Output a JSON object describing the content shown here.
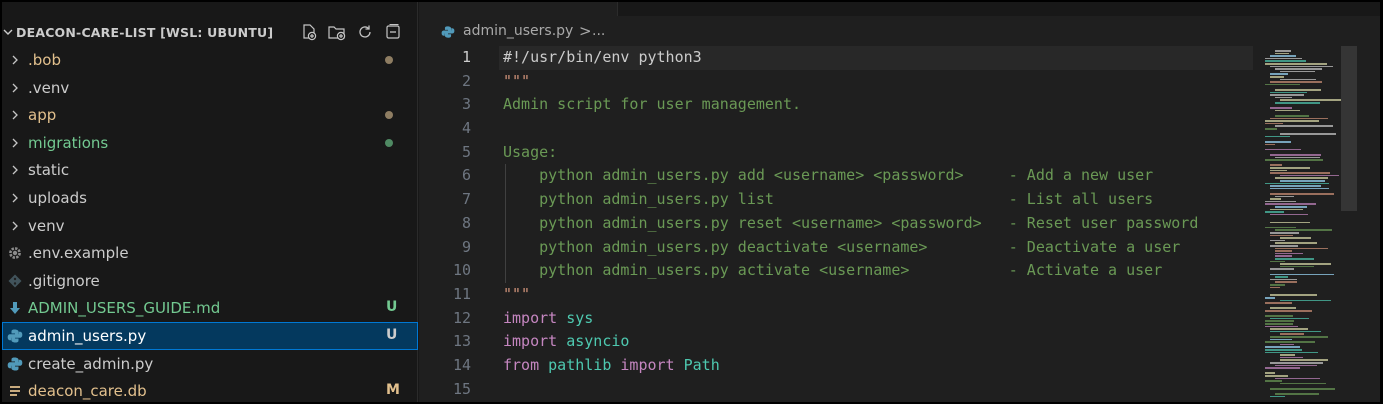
{
  "explorer": {
    "title": "DEACON-CARE-LIST [WSL: UBUNTU]",
    "actions": [
      {
        "name": "new-file-icon"
      },
      {
        "name": "new-folder-icon"
      },
      {
        "name": "refresh-icon"
      },
      {
        "name": "collapse-all-icon"
      }
    ],
    "items": [
      {
        "label": ".bob",
        "kind": "folder",
        "color": "#e2c08d",
        "decoration": "dot",
        "deco_color": "#8e7d62"
      },
      {
        "label": ".venv",
        "kind": "folder",
        "color": "#cccccc",
        "decoration": "",
        "deco_color": ""
      },
      {
        "label": "app",
        "kind": "folder",
        "color": "#e2c08d",
        "decoration": "dot",
        "deco_color": "#8e7d62"
      },
      {
        "label": "migrations",
        "kind": "folder",
        "color": "#73c991",
        "decoration": "dot",
        "deco_color": "#4f8a63"
      },
      {
        "label": "static",
        "kind": "folder",
        "color": "#cccccc",
        "decoration": "",
        "deco_color": ""
      },
      {
        "label": "uploads",
        "kind": "folder",
        "color": "#cccccc",
        "decoration": "",
        "deco_color": ""
      },
      {
        "label": "venv",
        "kind": "folder",
        "color": "#cccccc",
        "decoration": "",
        "deco_color": ""
      },
      {
        "label": ".env.example",
        "kind": "file",
        "icon": "gear-icon",
        "color": "#cccccc",
        "decoration": "",
        "deco_color": ""
      },
      {
        "label": ".gitignore",
        "kind": "file",
        "icon": "git-icon",
        "color": "#cccccc",
        "decoration": "",
        "deco_color": ""
      },
      {
        "label": "ADMIN_USERS_GUIDE.md",
        "kind": "file",
        "icon": "markdown-icon",
        "color": "#73c991",
        "decoration": "U",
        "deco_color": "#73c991"
      },
      {
        "label": "admin_users.py",
        "kind": "file",
        "icon": "python-icon",
        "color": "#ffffff",
        "decoration": "U",
        "deco_color": "#cccccc",
        "selected": true
      },
      {
        "label": "create_admin.py",
        "kind": "file",
        "icon": "python-icon",
        "color": "#cccccc",
        "decoration": "",
        "deco_color": ""
      },
      {
        "label": "deacon_care.db",
        "kind": "file",
        "icon": "database-icon",
        "color": "#e2c08d",
        "decoration": "M",
        "deco_color": "#e2c08d"
      }
    ]
  },
  "breadcrumb": {
    "file": "admin_users.py",
    "separator": ">",
    "more": "..."
  },
  "editor": {
    "current_line": 1,
    "lines": [
      {
        "n": "1",
        "tokens": [
          {
            "t": "#!/usr/bin/env python3",
            "c": "c-tx"
          }
        ]
      },
      {
        "n": "2",
        "tokens": [
          {
            "t": "\"\"\"",
            "c": "c-str"
          }
        ]
      },
      {
        "n": "3",
        "tokens": [
          {
            "t": "Admin script for user management.",
            "c": "c-cm"
          }
        ]
      },
      {
        "n": "4",
        "tokens": []
      },
      {
        "n": "5",
        "tokens": [
          {
            "t": "Usage:",
            "c": "c-cm"
          }
        ]
      },
      {
        "n": "6",
        "guide": true,
        "tokens": [
          {
            "t": "    python admin_users.py add <username> <password>     - Add a new user",
            "c": "c-cm"
          }
        ]
      },
      {
        "n": "7",
        "guide": true,
        "tokens": [
          {
            "t": "    python admin_users.py list                          - List all users",
            "c": "c-cm"
          }
        ]
      },
      {
        "n": "8",
        "guide": true,
        "tokens": [
          {
            "t": "    python admin_users.py reset <username> <password>   - Reset user password",
            "c": "c-cm"
          }
        ]
      },
      {
        "n": "9",
        "guide": true,
        "tokens": [
          {
            "t": "    python admin_users.py deactivate <username>         - Deactivate a user",
            "c": "c-cm"
          }
        ]
      },
      {
        "n": "10",
        "guide": true,
        "tokens": [
          {
            "t": "    python admin_users.py activate <username>           - Activate a user",
            "c": "c-cm"
          }
        ]
      },
      {
        "n": "11",
        "tokens": [
          {
            "t": "\"\"\"",
            "c": "c-str"
          }
        ]
      },
      {
        "n": "12",
        "tokens": [
          {
            "t": "import",
            "c": "c-kw"
          },
          {
            "t": " sys",
            "c": "c-mod"
          }
        ]
      },
      {
        "n": "13",
        "tokens": [
          {
            "t": "import",
            "c": "c-kw"
          },
          {
            "t": " asyncio",
            "c": "c-mod"
          }
        ]
      },
      {
        "n": "14",
        "tokens": [
          {
            "t": "from",
            "c": "c-kw"
          },
          {
            "t": " pathlib ",
            "c": "c-mod"
          },
          {
            "t": "import",
            "c": "c-kw"
          },
          {
            "t": " Path",
            "c": "c-mod"
          }
        ]
      },
      {
        "n": "15",
        "tokens": []
      }
    ]
  },
  "colors": {
    "sidebar_bg": "#181818",
    "editor_bg": "#1f1f1f",
    "selection_bg": "#04395e",
    "focus_border": "#0078d4",
    "git_untracked": "#73c991",
    "git_modified": "#e2c08d"
  }
}
